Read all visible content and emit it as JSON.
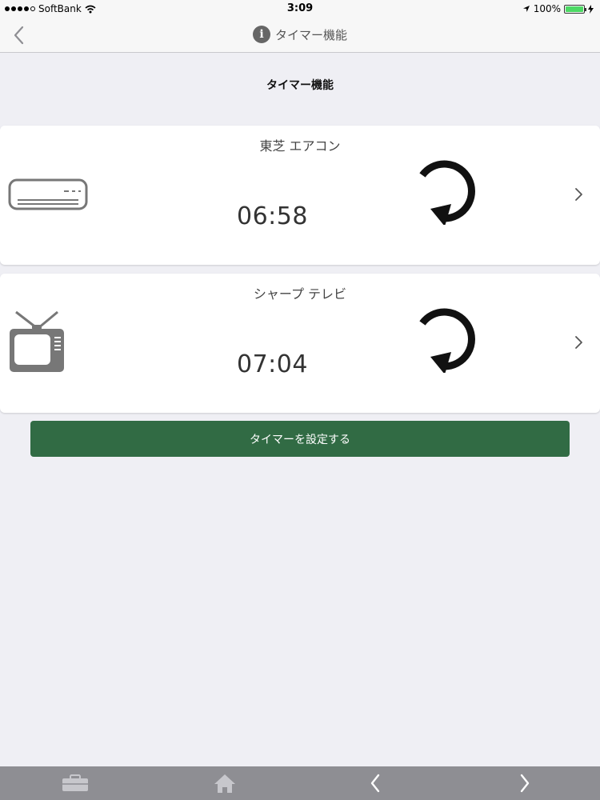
{
  "status_bar": {
    "carrier": "SoftBank",
    "time": "3:09",
    "battery": "100%",
    "battery_level": 1.0
  },
  "nav": {
    "title": "タイマー機能",
    "back_icon": "chevron-left-icon",
    "info_glyph": "i"
  },
  "section_title": "タイマー機能",
  "devices": [
    {
      "name": "東芝 エアコン",
      "time": "06:58",
      "icon": "air-conditioner-icon",
      "repeat_icon": "repeat-icon"
    },
    {
      "name": "シャープ テレビ",
      "time": "07:04",
      "icon": "tv-icon",
      "repeat_icon": "repeat-icon"
    }
  ],
  "set_timer_label": "タイマーを設定する",
  "colors": {
    "accent": "#316b44",
    "background": "#efeff4",
    "tab_bar": "#8e8e93"
  },
  "tab_bar": [
    {
      "icon": "toolbox-icon"
    },
    {
      "icon": "home-icon"
    },
    {
      "icon": "chevron-left-icon"
    },
    {
      "icon": "chevron-right-icon"
    }
  ]
}
